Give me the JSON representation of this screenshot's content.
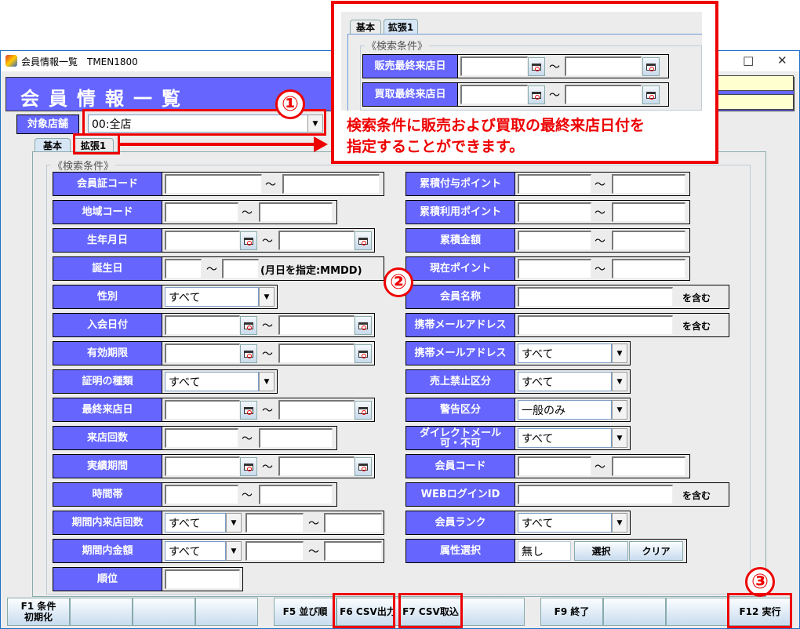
{
  "window": {
    "title": "会員情報一覧　TMEN1800",
    "minimize": "□",
    "close": "✕"
  },
  "header": {
    "title": "会員情報一覧"
  },
  "store": {
    "label": "対象店舗",
    "value": "00:全店"
  },
  "tabs": [
    "基本",
    "拡張1"
  ],
  "fieldset_legend": "《検索条件》",
  "tilde": "～",
  "contains": "を含む",
  "left_rows": [
    {
      "label": "会員証コード",
      "type": "range-wide"
    },
    {
      "label": "地域コード",
      "type": "range"
    },
    {
      "label": "生年月日",
      "type": "date"
    },
    {
      "label": "誕生日",
      "type": "mmdd",
      "note": "(月日を指定:MMDD)"
    },
    {
      "label": "性別",
      "type": "select",
      "value": "すべて"
    },
    {
      "label": "入会日付",
      "type": "date"
    },
    {
      "label": "有効期限",
      "type": "date"
    },
    {
      "label": "証明の種類",
      "type": "select",
      "value": "すべて"
    },
    {
      "label": "最終来店日",
      "type": "date"
    },
    {
      "label": "来店回数",
      "type": "range"
    },
    {
      "label": "実績期間",
      "type": "date"
    },
    {
      "label": "時間帯",
      "type": "range"
    },
    {
      "label": "期間内来店回数",
      "type": "select-range",
      "value": "すべて"
    },
    {
      "label": "期間内金額",
      "type": "select-range",
      "value": "すべて"
    },
    {
      "label": "順位",
      "type": "single"
    }
  ],
  "right_rows": [
    {
      "label": "累積付与ポイント",
      "type": "range"
    },
    {
      "label": "累積利用ポイント",
      "type": "range"
    },
    {
      "label": "累積金額",
      "type": "range"
    },
    {
      "label": "現在ポイント",
      "type": "range"
    },
    {
      "label": "会員名称",
      "type": "contains"
    },
    {
      "label": "携帯メールアドレス",
      "type": "contains"
    },
    {
      "label": "携帯メールアドレス",
      "type": "select",
      "value": "すべて"
    },
    {
      "label": "売上禁止区分",
      "type": "select",
      "value": "すべて"
    },
    {
      "label": "警告区分",
      "type": "select",
      "value": "一般のみ"
    },
    {
      "label": "ダイレクトメール\n可・不可",
      "type": "select",
      "value": "すべて"
    },
    {
      "label": "会員コード",
      "type": "range"
    },
    {
      "label": "WEBログインID",
      "type": "contains"
    },
    {
      "label": "会員ランク",
      "type": "select",
      "value": "すべて"
    },
    {
      "label": "属性選択",
      "type": "attr",
      "value": "無し",
      "select": "選択",
      "clear": "クリア"
    }
  ],
  "footer": [
    {
      "label": "F1 条件\n初期化"
    },
    {
      "label": ""
    },
    {
      "label": ""
    },
    {
      "label": ""
    },
    {
      "label": "F5 並び順"
    },
    {
      "label": "F6 CSV出力"
    },
    {
      "label": "F7 CSV取込"
    },
    {
      "label": ""
    },
    {
      "label": "F9 終了"
    },
    {
      "label": ""
    },
    {
      "label": ""
    },
    {
      "label": "F12 実行"
    }
  ],
  "callout": {
    "tabs": [
      "基本",
      "拡張1"
    ],
    "legend": "《検索条件》",
    "rows": [
      {
        "label": "販売最終来店日"
      },
      {
        "label": "買取最終来店日"
      }
    ],
    "text_line1": "検索条件に販売および買取の最終来店日付を",
    "text_line2": "指定することができます。"
  },
  "markers": [
    "①",
    "②",
    "③"
  ],
  "colors": {
    "label_bg": "#6666ff",
    "annotation": "#ee0000",
    "info_bg": "#ffffd0"
  }
}
